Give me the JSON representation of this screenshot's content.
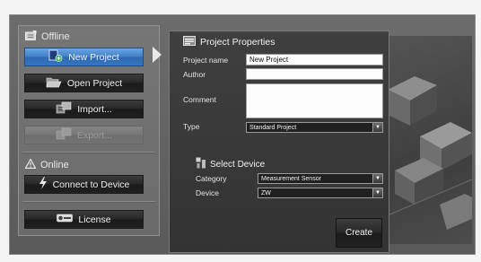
{
  "sidebar": {
    "offline_heading": "Offline",
    "online_heading": "Online",
    "new_project": "New Project",
    "open_project": "Open Project",
    "import": "Import...",
    "export": "Export...",
    "connect_to_device": "Connect to Device",
    "license": "License"
  },
  "project_properties": {
    "title": "Project Properties",
    "project_name_label": "Project name",
    "project_name_value": "New Project",
    "author_label": "Author",
    "author_value": "",
    "comment_label": "Comment",
    "comment_value": "",
    "type_label": "Type",
    "type_value": "Standard Project",
    "select_device_heading": "Select Device",
    "category_label": "Category",
    "category_value": "Measurement Sensor",
    "device_label": "Device",
    "device_value": "ZW",
    "create_label": "Create"
  },
  "colors": {
    "active_button": "#3f7ec6",
    "panel_background": "#333333",
    "frame_background": "#5a5a5a"
  }
}
